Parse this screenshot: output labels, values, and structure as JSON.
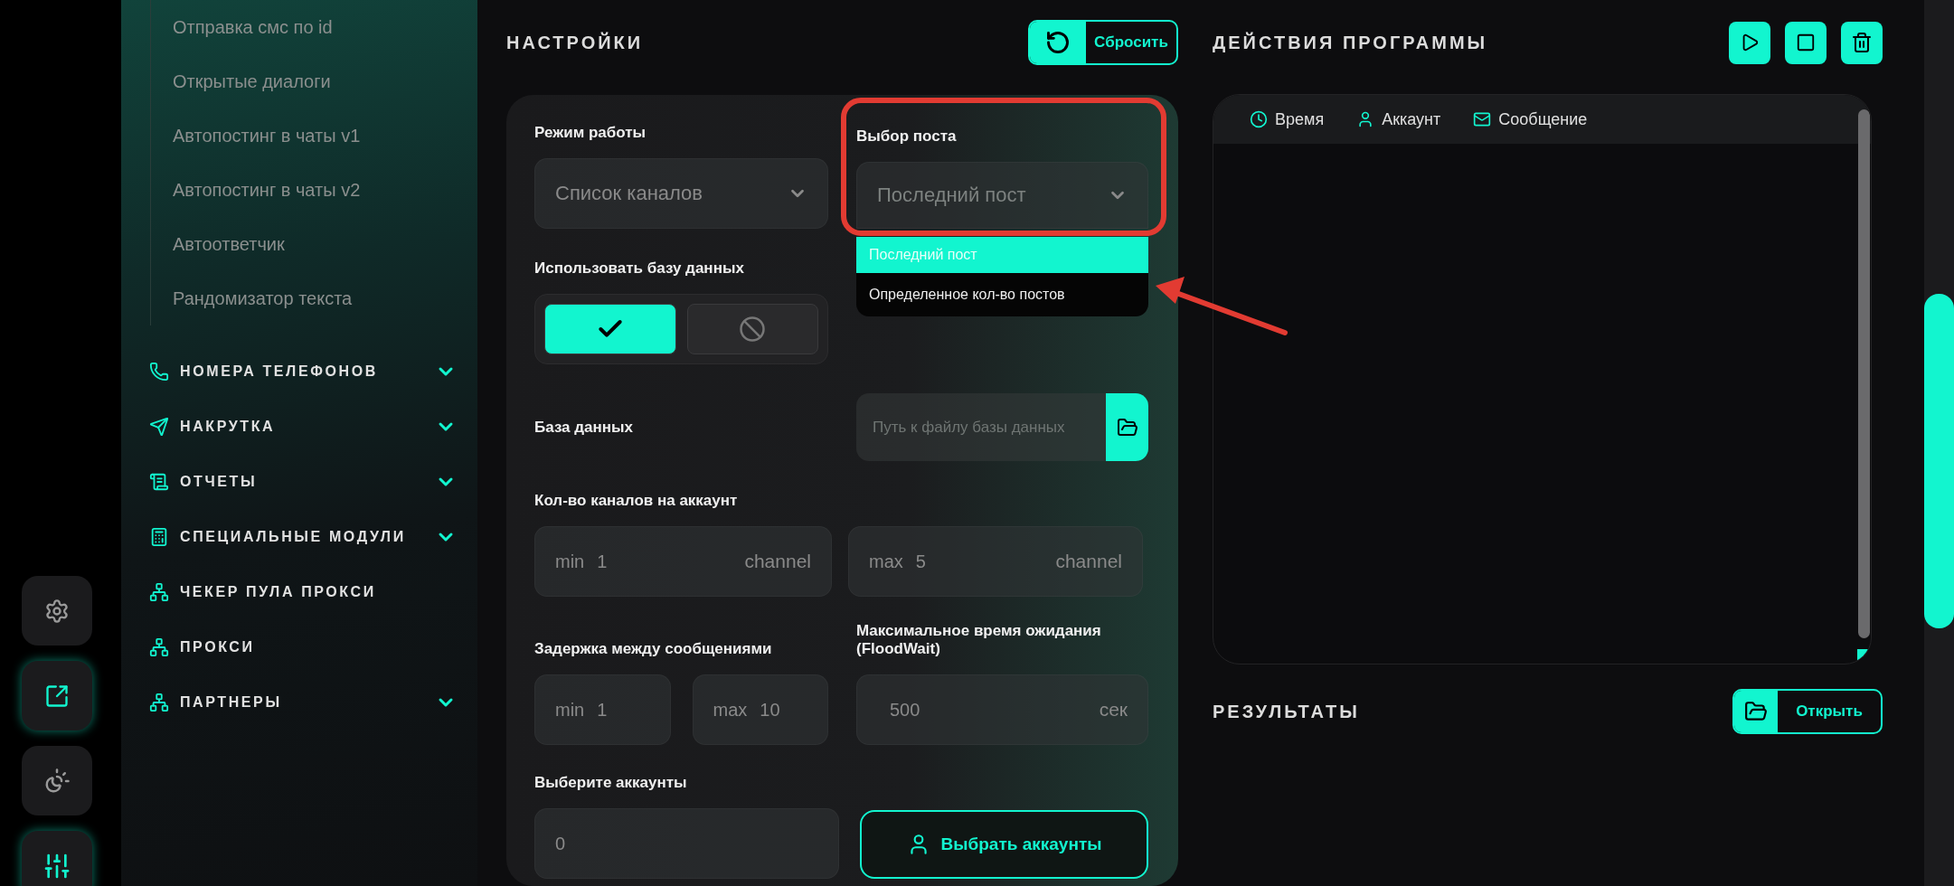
{
  "rail": [
    {
      "kind": "settings",
      "selected": false
    },
    {
      "kind": "export",
      "selected": true
    },
    {
      "kind": "theme",
      "selected": false
    },
    {
      "kind": "sliders",
      "selected": true
    }
  ],
  "sidebar": {
    "subitems": [
      "Отправка смс по id",
      "Открытые диалоги",
      "Автопостинг в чаты v1",
      "Автопостинг в чаты v2",
      "Автоответчик",
      "Рандомизатор текста"
    ],
    "sections": [
      {
        "label": "НОМЕРА ТЕЛЕФОНОВ",
        "kind": "phone",
        "expandable": true
      },
      {
        "label": "НАКРУТКА",
        "kind": "send",
        "expandable": true
      },
      {
        "label": "ОТЧЕТЫ",
        "kind": "report",
        "expandable": true
      },
      {
        "label": "СПЕЦИАЛЬНЫЕ МОДУЛИ",
        "kind": "modules",
        "expandable": true
      },
      {
        "label": "ЧЕКЕР ПУЛА ПРОКСИ",
        "kind": "network",
        "expandable": false
      },
      {
        "label": "ПРОКСИ",
        "kind": "network",
        "expandable": false
      },
      {
        "label": "ПАРТНЕРЫ",
        "kind": "network",
        "expandable": true
      }
    ]
  },
  "settings": {
    "title": "НАСТРОЙКИ",
    "reset_button": "Сбросить",
    "mode": {
      "label": "Режим работы",
      "value": "Список каналов"
    },
    "post_select": {
      "label": "Выбор поста",
      "value": "Последний пост",
      "open": true,
      "highlighted": true,
      "options": [
        {
          "label": "Последний пост",
          "selected": true
        },
        {
          "label": "Определенное кол-во постов",
          "selected": false
        }
      ]
    },
    "use_database": {
      "label": "Использовать базу данных",
      "options": [
        {
          "kind": "yes",
          "selected": true
        },
        {
          "kind": "no",
          "selected": false
        }
      ]
    },
    "database": {
      "label": "База данных",
      "placeholder": "Путь к файлу базы данных"
    },
    "channels_per_account": {
      "label": "Кол-во каналов на аккаунт",
      "min": {
        "prefix": "min",
        "value": "1",
        "unit": "channel"
      },
      "max": {
        "prefix": "max",
        "value": "5",
        "unit": "channel"
      }
    },
    "delay": {
      "label": "Задержка между сообщениями",
      "min": {
        "prefix": "min",
        "value": "1"
      },
      "max": {
        "prefix": "max",
        "value": "10"
      }
    },
    "floodwait": {
      "label": "Максимальное время ожидания (FloodWait)",
      "value": "500",
      "unit": "сек"
    },
    "accounts": {
      "label": "Выберите аккаунты",
      "value": "0",
      "button": "Выбрать аккаунты"
    }
  },
  "actions": {
    "title": "ДЕЙСТВИЯ ПРОГРАММЫ",
    "controls": [
      {
        "kind": "play"
      },
      {
        "kind": "stop"
      },
      {
        "kind": "delete"
      }
    ],
    "columns": [
      {
        "label": "Время",
        "kind": "time"
      },
      {
        "label": "Аккаунт",
        "kind": "account"
      },
      {
        "label": "Сообщение",
        "kind": "message"
      }
    ]
  },
  "results": {
    "title": "РЕЗУЛЬТАТЫ",
    "open_button": "Открыть"
  }
}
